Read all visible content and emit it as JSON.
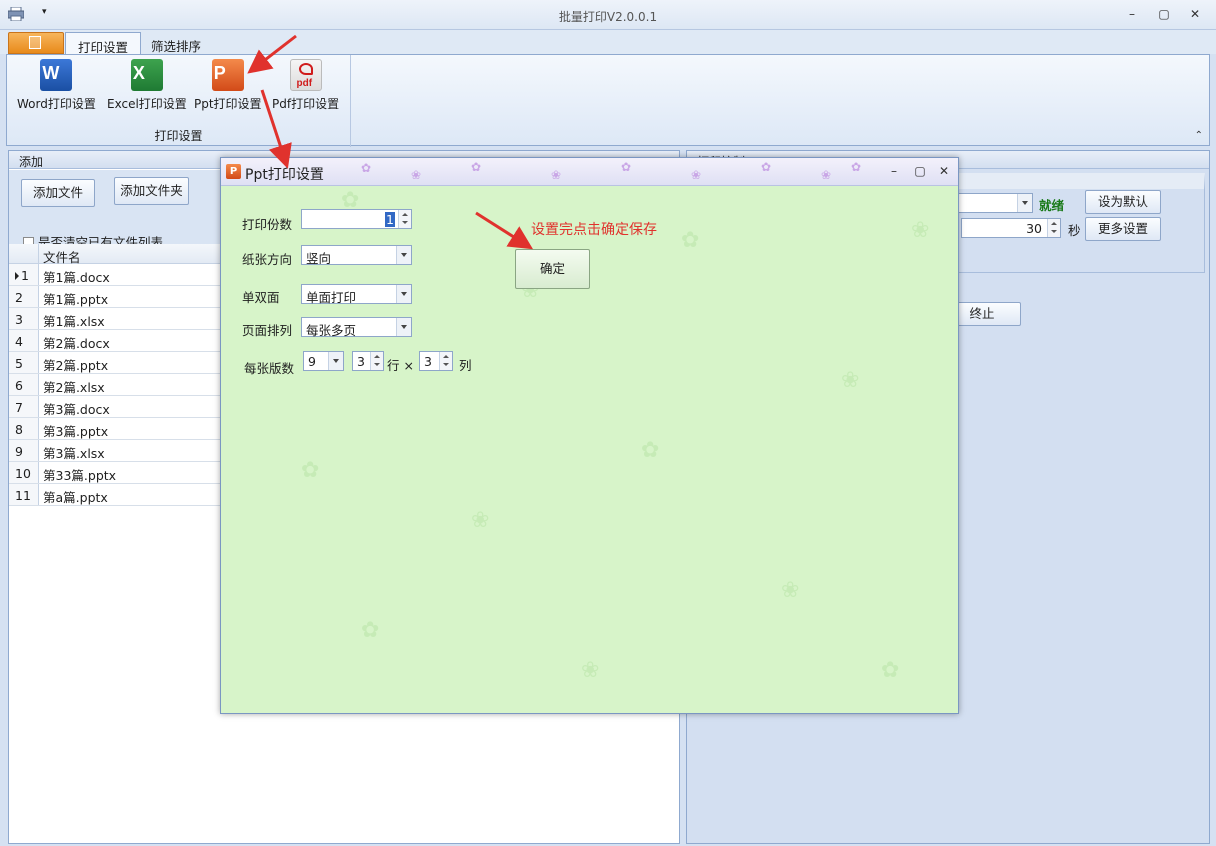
{
  "window": {
    "title": "批量打印V2.0.0.1",
    "minimize": "–",
    "restore": "▢",
    "close": "✕"
  },
  "ribbon": {
    "tabs": [
      {
        "label": "打印设置"
      },
      {
        "label": "筛选排序"
      }
    ],
    "group_title": "打印设置",
    "buttons": [
      {
        "label": "Word打印设置",
        "icon": "word-icon",
        "letter": "W"
      },
      {
        "label": "Excel打印设置",
        "icon": "excel-icon",
        "letter": "X"
      },
      {
        "label": "Ppt打印设置",
        "icon": "powerpoint-icon",
        "letter": "P"
      },
      {
        "label": "Pdf打印设置",
        "icon": "pdf-icon",
        "letter": "pdf"
      }
    ]
  },
  "left_panel": {
    "header": "添加",
    "add_file": "添加文件",
    "add_folder": "添加文件夹",
    "clear_checkbox": "是否清空已有文件列表",
    "column_header": "文件名",
    "rows": [
      {
        "num": "1",
        "name": "第1篇.docx"
      },
      {
        "num": "2",
        "name": "第1篇.pptx"
      },
      {
        "num": "3",
        "name": "第1篇.xlsx"
      },
      {
        "num": "4",
        "name": "第2篇.docx"
      },
      {
        "num": "5",
        "name": "第2篇.pptx"
      },
      {
        "num": "6",
        "name": "第2篇.xlsx"
      },
      {
        "num": "7",
        "name": "第3篇.docx"
      },
      {
        "num": "8",
        "name": "第3篇.pptx"
      },
      {
        "num": "9",
        "name": "第3篇.xlsx"
      },
      {
        "num": "10",
        "name": "第33篇.pptx"
      },
      {
        "num": "11",
        "name": "第a篇.pptx"
      }
    ]
  },
  "right_panel": {
    "header": "打印控制",
    "status": "就绪",
    "set_default": "设为默认",
    "interval_value": "30",
    "interval_unit": "秒",
    "more_settings": "更多设置",
    "stop": "终止"
  },
  "dialog": {
    "title": "Ppt打印设置",
    "copies_label": "打印份数",
    "copies_value": "1",
    "orientation_label": "纸张方向",
    "orientation_value": "竖向",
    "duplex_label": "单双面",
    "duplex_value": "单面打印",
    "layout_label": "页面排列",
    "layout_value": "每张多页",
    "per_sheet_label": "每张版数",
    "per_sheet_value": "9",
    "rows_value": "3",
    "rows_unit": "行 ×",
    "cols_value": "3",
    "cols_unit": "列",
    "ok_button": "确定"
  },
  "annotation": {
    "text": "设置完点击确定保存",
    "color": "#e0322d"
  }
}
